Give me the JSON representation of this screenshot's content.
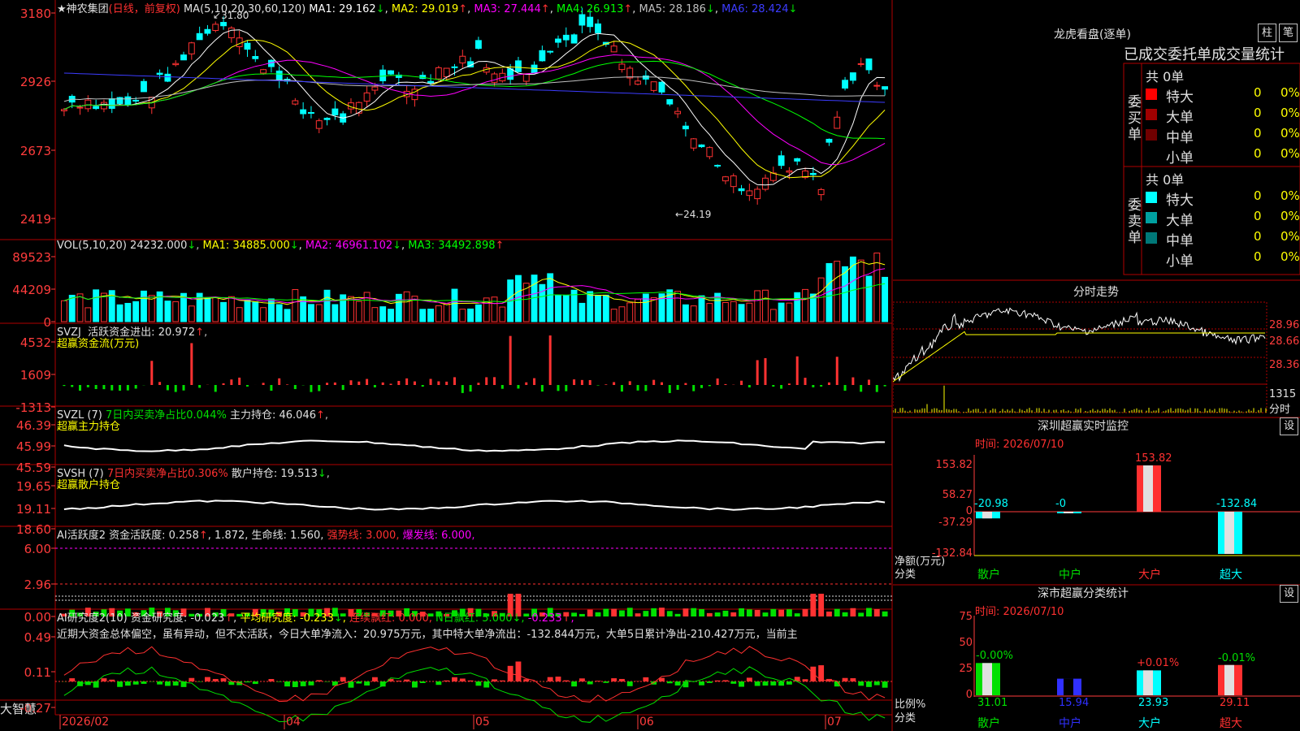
{
  "stock": {
    "star": "★",
    "name": "神农集团",
    "period": "(日线，前复权)"
  },
  "colors": {
    "up": "#ff3232",
    "down": "#00ffff",
    "ma1": "#ffffff",
    "ma2": "#ffff00",
    "ma3": "#ff00ff",
    "ma4": "#00ff00",
    "ma5": "#c0c0c0",
    "ma6": "#3c3cff",
    "green": "#00e000",
    "grid": "#b00000",
    "axis": "#ff3c3c"
  },
  "price": {
    "params": "MA(5,10,20,30,60,120)",
    "ma": [
      {
        "label": "MA1:",
        "value": "29.162",
        "arrow": "↓"
      },
      {
        "label": "MA2:",
        "value": "29.019",
        "arrow": "↑"
      },
      {
        "label": "MA3:",
        "value": "27.444",
        "arrow": "↑"
      },
      {
        "label": "MA4:",
        "value": "26.913",
        "arrow": "↑"
      },
      {
        "label": "MA5:",
        "value": "28.186",
        "arrow": "↓"
      },
      {
        "label": "MA6:",
        "value": "28.424",
        "arrow": "↓"
      }
    ],
    "ticks": [
      "3180",
      "2926",
      "2673",
      "2419"
    ],
    "high_label": "31.80",
    "low_label": "24.19"
  },
  "vol": {
    "params": "VOL(5,10,20)",
    "value": "24232.000",
    "value_arrow": "↓",
    "ma": [
      {
        "label": "MA1:",
        "value": "34885.000",
        "arrow": "↓"
      },
      {
        "label": "MA2:",
        "value": "46961.102",
        "arrow": "↓"
      },
      {
        "label": "MA3:",
        "value": "34492.898",
        "arrow": "↑"
      }
    ],
    "ticks": [
      "89523",
      "44209",
      "0"
    ]
  },
  "svzj": {
    "params": "SVZJ",
    "label": "活跃资金进出:",
    "value": "20.972",
    "arrow": "↑",
    "line2": "超赢资金流(万元)",
    "ticks": [
      "4532",
      "1609",
      "-1313"
    ]
  },
  "svzl": {
    "params": "SVZL (7)",
    "label1": "7日内买卖净占比0.044%",
    "label2": "主力持仓:",
    "value": "46.046",
    "arrow": "↑",
    "line2": "超赢主力持仓",
    "ticks": [
      "46.39",
      "45.99",
      "45.59"
    ]
  },
  "svsh": {
    "params": "SVSH (7)",
    "label1": "7日内买卖净占比0.306%",
    "label2": "散户持仓:",
    "value": "19.513",
    "arrow": "↓",
    "line2": "超赢散户持仓",
    "ticks": [
      "19.65",
      "19.11",
      "18.60"
    ]
  },
  "ai1": {
    "params": "AI活跃度2",
    "items": [
      {
        "text": "资金活跃度: 0.258",
        "arrow": "↑"
      },
      {
        "text": "1.872",
        "arrow": ""
      },
      {
        "text": "生命线: 1.560",
        "arrow": ""
      },
      {
        "text": "强势线: 3.000",
        "arrow": ""
      },
      {
        "text": "爆发线: 6.000",
        "arrow": ""
      }
    ],
    "ticks": [
      "6.00",
      "2.96",
      "0.00"
    ]
  },
  "ai2": {
    "params": "AI研究度2(10)",
    "items": [
      {
        "text": "资金研究度: -0.023",
        "arrow": "↑"
      },
      {
        "text": "平均研究度: -0.233",
        "arrow": "↓"
      },
      {
        "text": "连续飘红: 0.000",
        "arrow": ""
      },
      {
        "text": "N日飘红: 5.000",
        "arrow": "↓"
      },
      {
        "text": "-0.233",
        "arrow": "↑"
      }
    ],
    "comment": "近期大资金总体偏空，虽有异动，但不太活跃，今日大单净流入：20.975万元，其中特大单净流出：-132.844万元，大单5日累计净出-210.427万元，当前主",
    "ticks": [
      "0.49",
      "0.11",
      "-0.27"
    ]
  },
  "xaxis": {
    "brand": "大智慧",
    "labels": [
      "2026/02",
      "04",
      "05",
      "06",
      "07"
    ]
  },
  "dragon": {
    "title": "龙虎看盘(逐单)",
    "btn_zhu": "柱",
    "btn_bi": "笔",
    "subtitle": "已成交委托单成交量统计",
    "buy": {
      "label": "委买单",
      "total": "共 0单",
      "rows": [
        {
          "name": "特大",
          "count": "0",
          "pct": "0%",
          "color": "#ff0000"
        },
        {
          "name": "大单",
          "count": "0",
          "pct": "0%",
          "color": "#a00000"
        },
        {
          "name": "中单",
          "count": "0",
          "pct": "0%",
          "color": "#700000"
        },
        {
          "name": "小单",
          "count": "0",
          "pct": "0%",
          "color": ""
        }
      ]
    },
    "sell": {
      "label": "委卖单",
      "total": "共 0单",
      "rows": [
        {
          "name": "特大",
          "count": "0",
          "pct": "0%",
          "color": "#00ffff"
        },
        {
          "name": "大单",
          "count": "0",
          "pct": "0%",
          "color": "#00a0a0"
        },
        {
          "name": "中单",
          "count": "0",
          "pct": "0%",
          "color": "#007878"
        },
        {
          "name": "小单",
          "count": "0",
          "pct": "0%",
          "color": ""
        }
      ]
    }
  },
  "intraday": {
    "title": "分时走势",
    "prices": [
      "28.96",
      "28.66",
      "28.36"
    ],
    "vol": "1315",
    "unit": "分时"
  },
  "monitor": {
    "title": "深圳超赢实时监控",
    "btn": "设",
    "time": "时间: 2026/07/10",
    "ticks": [
      "153.82",
      "58.27",
      "0",
      "-37.29",
      "-132.84"
    ],
    "ylabel": "净额(万元)",
    "xlabel": "分类",
    "categories": [
      "散户",
      "中户",
      "大户",
      "超大"
    ],
    "values": [
      -20.98,
      -0.0,
      153.82,
      -132.84
    ],
    "value_labels": [
      "-20.98",
      "-0",
      "153.82",
      "-132.84"
    ]
  },
  "stats": {
    "title": "深市超赢分类统计",
    "btn": "设",
    "time": "时间: 2026/07/10",
    "ticks": [
      "75",
      "50",
      "25",
      "0"
    ],
    "ylabel": "比例%",
    "xlabel": "分类",
    "categories": [
      "散户",
      "中户",
      "大户",
      "超大"
    ],
    "values": [
      31.01,
      15.94,
      23.93,
      29.11
    ],
    "change_labels": [
      "-0.00%",
      "",
      "+0.01%",
      "-0.01%"
    ],
    "value_labels": [
      "31.01",
      "15.94",
      "23.93",
      "29.11"
    ],
    "bar_colors": [
      "#00e000",
      "#3030ff",
      "#00ffff",
      "#ff3030"
    ]
  }
}
